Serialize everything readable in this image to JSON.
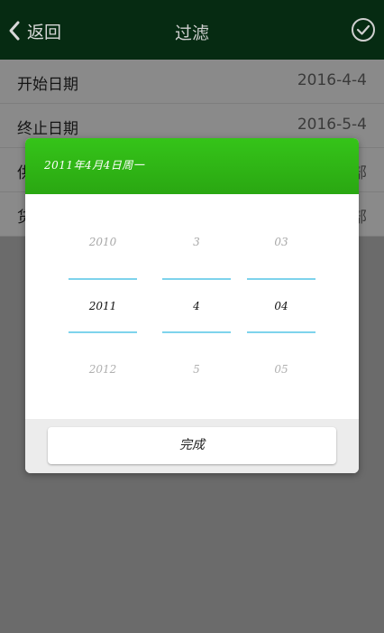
{
  "top_bar": {
    "back_label": "返回",
    "title": "过滤",
    "back_icon": "chevron-left-icon",
    "confirm_icon": "check-circle-icon",
    "background": "#062b12"
  },
  "filter_list": [
    {
      "label": "开始日期",
      "value": "2016-4-4"
    },
    {
      "label": "终止日期",
      "value": "2016-5-4"
    },
    {
      "label": "供",
      "value": "部"
    },
    {
      "label": "货",
      "value": "部"
    }
  ],
  "dialog": {
    "title": "2011年4月4日周一",
    "header_color": "#2fb716",
    "year_wheel": {
      "prev": "2010",
      "current": "2011",
      "next": "2012"
    },
    "month_wheel": {
      "prev": "3",
      "current": "4",
      "next": "5"
    },
    "day_wheel": {
      "prev": "03",
      "current": "04",
      "next": "05"
    },
    "done_label": "完成"
  }
}
